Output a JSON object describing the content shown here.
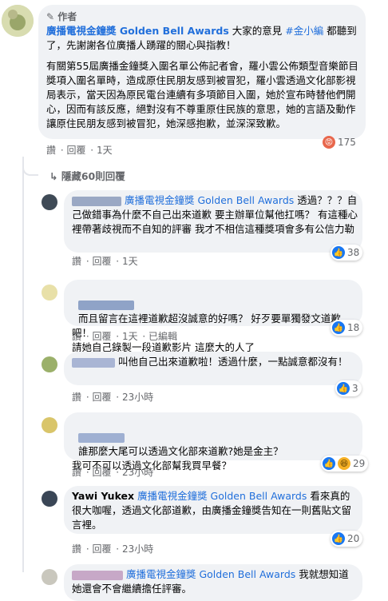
{
  "post": {
    "author_badge": "作者",
    "page_name": "廣播電視金鐘獎 Golden Bell Awards",
    "line1_rest": " 大家的意見 ",
    "hashtag": "#金小編",
    "line1_tail": " 都聽到了，先謝謝各位廣播人踴躍的關心與指教！",
    "paragraph": "有關第55屆廣播金鐘獎入圍名單公佈記者會，羅小雲公佈類型音樂節目獎項入圍名單時，造成原住民朋友感到被冒犯，羅小雲透過文化部影視局表示，當天因為原民電台連續有多項節目入圍，她於宣布時替他們開心，因而有該反應，絕對沒有不尊重原住民族的意思，她的言語及動作讓原住民朋友感到被冒犯，她深感抱歉，並深深致歉。",
    "actions": [
      "讚",
      "回覆",
      "1天"
    ],
    "reaction_count": "175",
    "reaction_icon": "angry-face"
  },
  "hidden_replies": "隱藏60則回覆",
  "replies": [
    {
      "name": "",
      "tag": "廣播電視金鐘獎 Golden Bell Awards",
      "text": " 透過？？？自己做錯事為什麼不自己出來道歉 要主辦單位幫他扛嗎？ 有這種心裡帶著歧視而不自知的評審 我才不相信這種獎項會多有公信力勒",
      "actions": [
        "讚",
        "回覆",
        "1天"
      ],
      "count": "38",
      "icons": [
        "like"
      ]
    },
    {
      "name": "",
      "tag": "",
      "text": "而且留言在這裡道歉超沒誠意的好嗎？ 好歹要單獨發文道歉吧！\n請她自己錄製一段道歉影片 這麼大的人了",
      "actions": [
        "讚",
        "回覆",
        "1天",
        "已編輯"
      ],
      "count": "18",
      "icons": [
        "like"
      ]
    },
    {
      "name": "",
      "tag": "",
      "text": "叫他自己出來道歉啦！透過什麼，一點誠意都沒有！",
      "actions": [
        "讚",
        "回覆",
        "23小時"
      ],
      "count": "3",
      "icons": [
        "like"
      ]
    },
    {
      "name": "",
      "tag": "",
      "text": "誰那麼大尾可以透過文化部來道歉?她是金主？\n我可不可以透過文化部幫我買早餐？",
      "actions": [
        "讚",
        "回覆",
        "23小時"
      ],
      "count": "29",
      "icons": [
        "like",
        "haha"
      ]
    },
    {
      "name": "Yawi Yukex",
      "tag": "廣播電視金鐘獎 Golden Bell Awards",
      "text": " 看來真的很大咖喔，透過文化部道歉，由廣播金鐘獎告知在一則舊貼文留言裡。",
      "actions": [
        "讚",
        "回覆",
        "23小時"
      ],
      "count": "20",
      "icons": [
        "like"
      ]
    },
    {
      "name": "",
      "tag": "廣播電視金鐘獎 Golden Bell Awards",
      "text": " 我就想知道她還會不會繼續擔任評審。",
      "actions": [],
      "count": "",
      "icons": []
    }
  ],
  "colors": {
    "link": "#216fdb",
    "bubble": "#f0f2f5",
    "meta": "#65676b",
    "like": "#1877f2",
    "angry": "#e8674c"
  }
}
